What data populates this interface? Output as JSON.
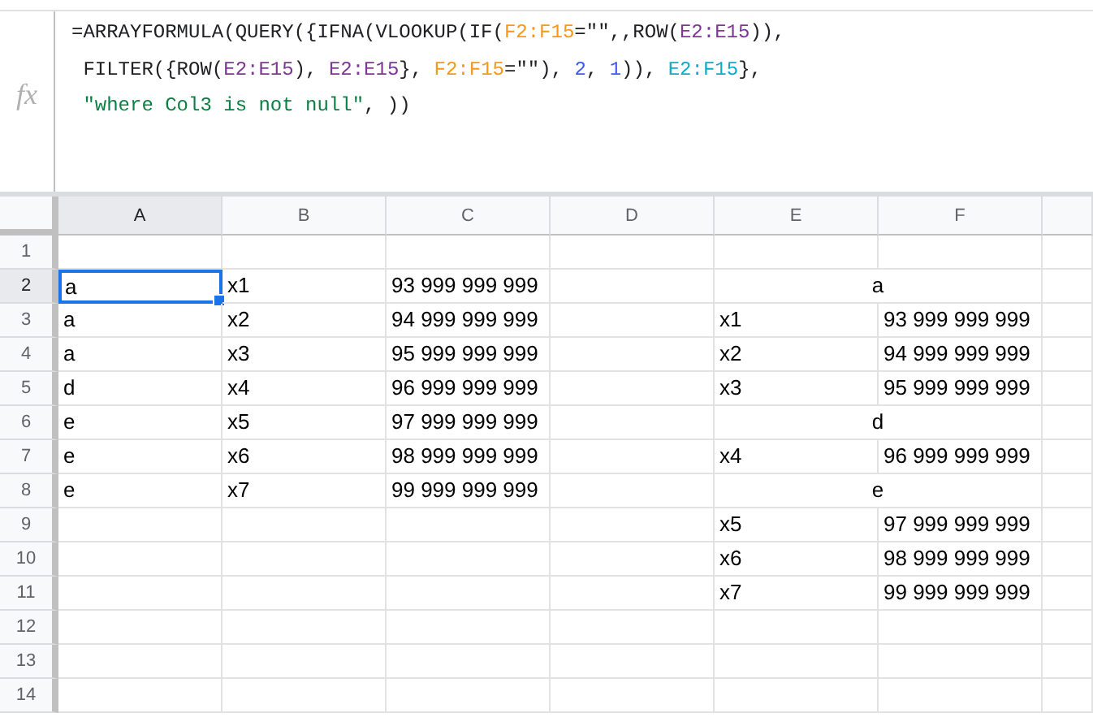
{
  "formula_bar": {
    "icon_text": "fx",
    "lines": [
      [
        {
          "text": "=ARRAYFORMULA(QUERY({IFNA(VLOOKUP(IF(",
          "color": "#202124"
        },
        {
          "text": "F2:F15",
          "color": "#f7981d"
        },
        {
          "text": "=\"\",,ROW(",
          "color": "#202124"
        },
        {
          "text": "E2:E15",
          "color": "#7e3794"
        },
        {
          "text": ")),",
          "color": "#202124"
        }
      ],
      [
        {
          "text": " FILTER({ROW(",
          "color": "#202124"
        },
        {
          "text": "E2:E15",
          "color": "#7e3794"
        },
        {
          "text": "), ",
          "color": "#202124"
        },
        {
          "text": "E2:E15",
          "color": "#7e3794"
        },
        {
          "text": "}, ",
          "color": "#202124"
        },
        {
          "text": "F2:F15",
          "color": "#f7981d"
        },
        {
          "text": "=\"\"), ",
          "color": "#202124"
        },
        {
          "text": "2",
          "color": "#3d5afe"
        },
        {
          "text": ", ",
          "color": "#202124"
        },
        {
          "text": "1",
          "color": "#3d5afe"
        },
        {
          "text": ")), ",
          "color": "#202124"
        },
        {
          "text": "E2:F15",
          "color": "#11a9cc"
        },
        {
          "text": "},",
          "color": "#202124"
        }
      ],
      [
        {
          "text": " \"where Col3 is not null\"",
          "color": "#0b8043"
        },
        {
          "text": ", ))",
          "color": "#202124"
        }
      ]
    ]
  },
  "columns": [
    {
      "label": "A",
      "selected": true
    },
    {
      "label": "B",
      "selected": false
    },
    {
      "label": "C",
      "selected": false
    },
    {
      "label": "D",
      "selected": false
    },
    {
      "label": "E",
      "selected": false
    },
    {
      "label": "F",
      "selected": false
    }
  ],
  "rows": [
    {
      "number": "1",
      "selected": false,
      "cells": [
        {
          "kind": "empty",
          "selected": false
        },
        {
          "kind": "empty",
          "selected": false
        },
        {
          "kind": "empty",
          "selected": false
        },
        {
          "kind": "empty",
          "selected": false
        },
        {
          "kind": "empty",
          "selected": false
        },
        {
          "kind": "empty",
          "selected": false
        }
      ]
    },
    {
      "number": "2",
      "selected": true,
      "cells": [
        {
          "text": "a",
          "selected": true,
          "kind": "plain"
        },
        {
          "text": "x1",
          "selected": false,
          "kind": "plain"
        },
        {
          "text": "93 999 999 999",
          "selected": false,
          "kind": "plain"
        },
        {
          "kind": "empty",
          "selected": false
        },
        {
          "text": "a",
          "selected": false,
          "kind": "merged"
        }
      ]
    },
    {
      "number": "3",
      "selected": false,
      "cells": [
        {
          "text": "a",
          "selected": false,
          "kind": "plain"
        },
        {
          "text": "x2",
          "selected": false,
          "kind": "plain"
        },
        {
          "text": "94 999 999 999",
          "selected": false,
          "kind": "plain"
        },
        {
          "kind": "empty",
          "selected": false
        },
        {
          "text": "x1",
          "selected": false,
          "kind": "plain"
        },
        {
          "text": "93 999 999 999",
          "selected": false,
          "kind": "plain"
        }
      ]
    },
    {
      "number": "4",
      "selected": false,
      "cells": [
        {
          "text": "a",
          "selected": false,
          "kind": "plain"
        },
        {
          "text": "x3",
          "selected": false,
          "kind": "plain"
        },
        {
          "text": "95 999 999 999",
          "selected": false,
          "kind": "plain"
        },
        {
          "kind": "empty",
          "selected": false
        },
        {
          "text": "x2",
          "selected": false,
          "kind": "plain"
        },
        {
          "text": "94 999 999 999",
          "selected": false,
          "kind": "plain"
        }
      ]
    },
    {
      "number": "5",
      "selected": false,
      "cells": [
        {
          "text": "d",
          "selected": false,
          "kind": "plain"
        },
        {
          "text": "x4",
          "selected": false,
          "kind": "plain"
        },
        {
          "text": "96 999 999 999",
          "selected": false,
          "kind": "plain"
        },
        {
          "kind": "empty",
          "selected": false
        },
        {
          "text": "x3",
          "selected": false,
          "kind": "plain"
        },
        {
          "text": "95 999 999 999",
          "selected": false,
          "kind": "plain"
        }
      ]
    },
    {
      "number": "6",
      "selected": false,
      "cells": [
        {
          "text": "e",
          "selected": false,
          "kind": "plain"
        },
        {
          "text": "x5",
          "selected": false,
          "kind": "plain"
        },
        {
          "text": "97 999 999 999",
          "selected": false,
          "kind": "plain"
        },
        {
          "kind": "empty",
          "selected": false
        },
        {
          "text": "d",
          "selected": false,
          "kind": "merged"
        }
      ]
    },
    {
      "number": "7",
      "selected": false,
      "cells": [
        {
          "text": "e",
          "selected": false,
          "kind": "plain"
        },
        {
          "text": "x6",
          "selected": false,
          "kind": "plain"
        },
        {
          "text": "98 999 999 999",
          "selected": false,
          "kind": "plain"
        },
        {
          "kind": "empty",
          "selected": false
        },
        {
          "text": "x4",
          "selected": false,
          "kind": "plain"
        },
        {
          "text": "96 999 999 999",
          "selected": false,
          "kind": "plain"
        }
      ]
    },
    {
      "number": "8",
      "selected": false,
      "cells": [
        {
          "text": "e",
          "selected": false,
          "kind": "plain"
        },
        {
          "text": "x7",
          "selected": false,
          "kind": "plain"
        },
        {
          "text": "99 999 999 999",
          "selected": false,
          "kind": "plain"
        },
        {
          "kind": "empty",
          "selected": false
        },
        {
          "text": "e",
          "selected": false,
          "kind": "merged"
        }
      ]
    },
    {
      "number": "9",
      "selected": false,
      "cells": [
        {
          "kind": "empty",
          "selected": false
        },
        {
          "kind": "empty",
          "selected": false
        },
        {
          "kind": "empty",
          "selected": false
        },
        {
          "kind": "empty",
          "selected": false
        },
        {
          "text": "x5",
          "selected": false,
          "kind": "plain"
        },
        {
          "text": "97 999 999 999",
          "selected": false,
          "kind": "plain"
        }
      ]
    },
    {
      "number": "10",
      "selected": false,
      "cells": [
        {
          "kind": "empty",
          "selected": false
        },
        {
          "kind": "empty",
          "selected": false
        },
        {
          "kind": "empty",
          "selected": false
        },
        {
          "kind": "empty",
          "selected": false
        },
        {
          "text": "x6",
          "selected": false,
          "kind": "plain"
        },
        {
          "text": "98 999 999 999",
          "selected": false,
          "kind": "plain"
        }
      ]
    },
    {
      "number": "11",
      "selected": false,
      "cells": [
        {
          "kind": "empty",
          "selected": false
        },
        {
          "kind": "empty",
          "selected": false
        },
        {
          "kind": "empty",
          "selected": false
        },
        {
          "kind": "empty",
          "selected": false
        },
        {
          "text": "x7",
          "selected": false,
          "kind": "plain"
        },
        {
          "text": "99 999 999 999",
          "selected": false,
          "kind": "plain"
        }
      ]
    },
    {
      "number": "12",
      "selected": false,
      "cells": [
        {
          "kind": "empty",
          "selected": false
        },
        {
          "kind": "empty",
          "selected": false
        },
        {
          "kind": "empty",
          "selected": false
        },
        {
          "kind": "empty",
          "selected": false
        },
        {
          "kind": "empty",
          "selected": false
        },
        {
          "kind": "empty",
          "selected": false
        }
      ]
    },
    {
      "number": "13",
      "selected": false,
      "cells": [
        {
          "kind": "empty",
          "selected": false
        },
        {
          "kind": "empty",
          "selected": false
        },
        {
          "kind": "empty",
          "selected": false
        },
        {
          "kind": "empty",
          "selected": false
        },
        {
          "kind": "empty",
          "selected": false
        },
        {
          "kind": "empty",
          "selected": false
        }
      ]
    },
    {
      "number": "14",
      "selected": false,
      "cells": [
        {
          "kind": "empty",
          "selected": false
        },
        {
          "kind": "empty",
          "selected": false
        },
        {
          "kind": "empty",
          "selected": false
        },
        {
          "kind": "empty",
          "selected": false
        },
        {
          "kind": "empty",
          "selected": false
        },
        {
          "kind": "empty",
          "selected": false
        }
      ]
    }
  ]
}
